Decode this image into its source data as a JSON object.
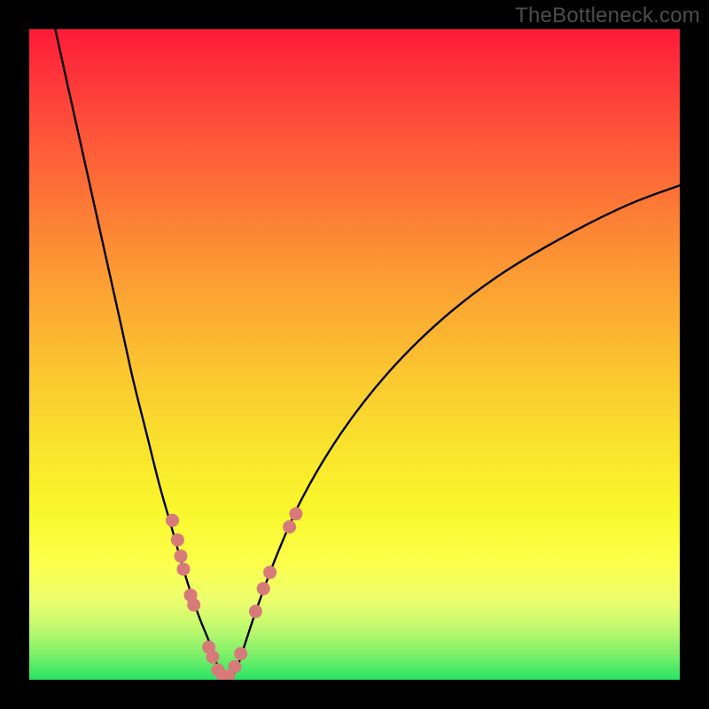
{
  "watermark": "TheBottleneck.com",
  "chart_data": {
    "type": "line",
    "title": "",
    "xlabel": "",
    "ylabel": "",
    "xlim": [
      0,
      100
    ],
    "ylim": [
      0,
      100
    ],
    "series": [
      {
        "name": "bottleneck-curve",
        "x": [
          4,
          6,
          8,
          10,
          12,
          14,
          16,
          18,
          20,
          22,
          24,
          26,
          28,
          29,
          30,
          31,
          32,
          33,
          35,
          38,
          42,
          48,
          55,
          63,
          72,
          82,
          92,
          100
        ],
        "y": [
          100,
          91,
          82,
          73,
          64,
          55,
          46,
          38,
          30,
          23,
          16,
          10,
          5,
          2,
          0.5,
          0.5,
          2,
          5,
          11,
          19,
          28,
          38,
          47,
          55,
          62,
          68,
          73,
          76
        ]
      }
    ],
    "markers": {
      "name": "highlight-dots",
      "color": "#d77a7a",
      "points": [
        {
          "x": 22.0,
          "y": 24.5
        },
        {
          "x": 22.8,
          "y": 21.5
        },
        {
          "x": 23.3,
          "y": 19.0
        },
        {
          "x": 23.7,
          "y": 17.0
        },
        {
          "x": 24.8,
          "y": 13.0
        },
        {
          "x": 25.3,
          "y": 11.5
        },
        {
          "x": 27.6,
          "y": 5.0
        },
        {
          "x": 28.2,
          "y": 3.5
        },
        {
          "x": 29.0,
          "y": 1.5
        },
        {
          "x": 29.8,
          "y": 0.5
        },
        {
          "x": 30.6,
          "y": 0.5
        },
        {
          "x": 31.6,
          "y": 2.0
        },
        {
          "x": 32.5,
          "y": 4.0
        },
        {
          "x": 34.8,
          "y": 10.5
        },
        {
          "x": 36.0,
          "y": 14.0
        },
        {
          "x": 37.0,
          "y": 16.5
        },
        {
          "x": 40.0,
          "y": 23.5
        },
        {
          "x": 41.0,
          "y": 25.5
        }
      ]
    },
    "gradient_stops": [
      {
        "pos": 0,
        "color": "#fe1b38"
      },
      {
        "pos": 10,
        "color": "#fe3f3b"
      },
      {
        "pos": 24,
        "color": "#fd6f37"
      },
      {
        "pos": 38,
        "color": "#fc9c33"
      },
      {
        "pos": 52,
        "color": "#fbc430"
      },
      {
        "pos": 64,
        "color": "#fae32d"
      },
      {
        "pos": 74,
        "color": "#f9f72c"
      },
      {
        "pos": 82,
        "color": "#fdff4b"
      },
      {
        "pos": 88,
        "color": "#ecfe6e"
      },
      {
        "pos": 92,
        "color": "#c1f96e"
      },
      {
        "pos": 96,
        "color": "#80f06a"
      },
      {
        "pos": 100,
        "color": "#28e464"
      }
    ]
  }
}
